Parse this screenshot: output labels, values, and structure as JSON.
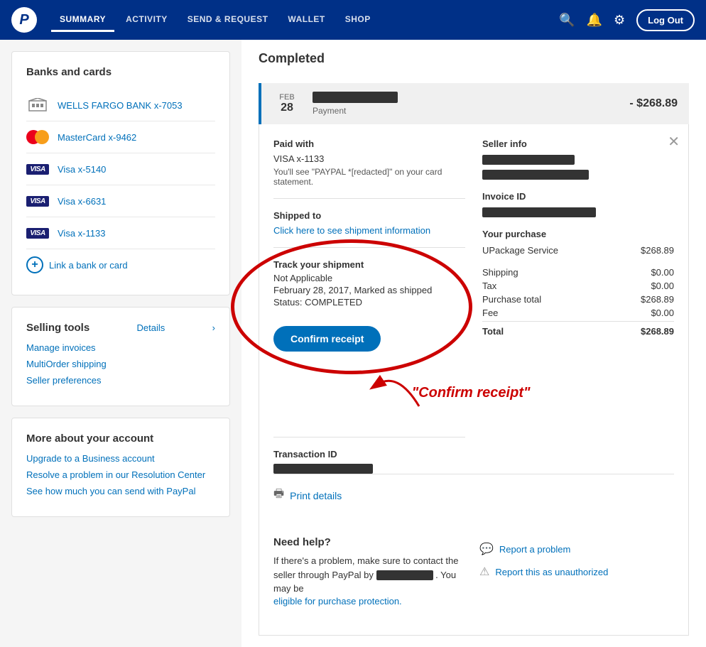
{
  "navbar": {
    "logo_text": "P",
    "links": [
      {
        "label": "SUMMARY",
        "active": true
      },
      {
        "label": "ACTIVITY",
        "active": false
      },
      {
        "label": "SEND & REQUEST",
        "active": false
      },
      {
        "label": "WALLET",
        "active": false
      },
      {
        "label": "SHOP",
        "active": false
      }
    ],
    "logout_label": "Log Out"
  },
  "sidebar": {
    "banks_title": "Banks and cards",
    "banks": [
      {
        "name": "WELLS FARGO BANK x-7053",
        "type": "bank"
      },
      {
        "name": "MasterCard x-9462",
        "type": "mastercard"
      },
      {
        "name": "Visa x-5140",
        "type": "visa"
      },
      {
        "name": "Visa x-6631",
        "type": "visa"
      },
      {
        "name": "Visa x-1133",
        "type": "visa"
      }
    ],
    "link_card_label": "Link a bank or card",
    "selling_title": "Selling tools",
    "details_label": "Details",
    "selling_links": [
      {
        "label": "Manage invoices"
      },
      {
        "label": "MultiOrder shipping"
      },
      {
        "label": "Seller preferences"
      }
    ],
    "more_title": "More about your account",
    "more_links": [
      {
        "label": "Upgrade to a Business account"
      },
      {
        "label": "Resolve a problem in our Resolution Center"
      },
      {
        "label": "See how much you can send with PayPal"
      }
    ]
  },
  "transaction": {
    "completed_label": "Completed",
    "date_month": "FEB",
    "date_day": "28",
    "type_label": "Payment",
    "amount": "- $268.89",
    "paid_with_title": "Paid with",
    "paid_with_value": "VISA x-1133",
    "card_statement_note": "You'll see \"PAYPAL *[redacted]\" on your card statement.",
    "seller_info_title": "Seller info",
    "shipped_to_title": "Shipped to",
    "shipped_link_text": "Click here to see shipment information",
    "invoice_id_title": "Invoice ID",
    "your_purchase_title": "Your purchase",
    "track_title": "Track your shipment",
    "track_not_applicable": "Not Applicable",
    "track_date": "February 28, 2017, Marked as shipped",
    "track_status": "Status: COMPLETED",
    "confirm_btn_label": "Confirm receipt",
    "transaction_id_label": "Transaction ID",
    "purchase_items": [
      {
        "label": "UPackage Service",
        "value": "$268.89"
      },
      {
        "label": "Shipping",
        "value": "$0.00"
      },
      {
        "label": "Tax",
        "value": "$0.00"
      },
      {
        "label": "Purchase total",
        "value": "$268.89"
      },
      {
        "label": "Fee",
        "value": "$0.00"
      },
      {
        "label": "Total",
        "value": "$268.89",
        "bold": true
      }
    ],
    "print_label": "Print details",
    "help_title": "Need help?",
    "help_text": "If there's a problem, make sure to contact the seller through PayPal by",
    "help_text2": ". You may be",
    "eligible_text": "eligible for purchase protection.",
    "help_links": [
      {
        "label": "Report a problem",
        "icon": "chat"
      },
      {
        "label": "Report this as unauthorized",
        "icon": "warning"
      }
    ],
    "annotation_label": "\"Confirm receipt\""
  }
}
